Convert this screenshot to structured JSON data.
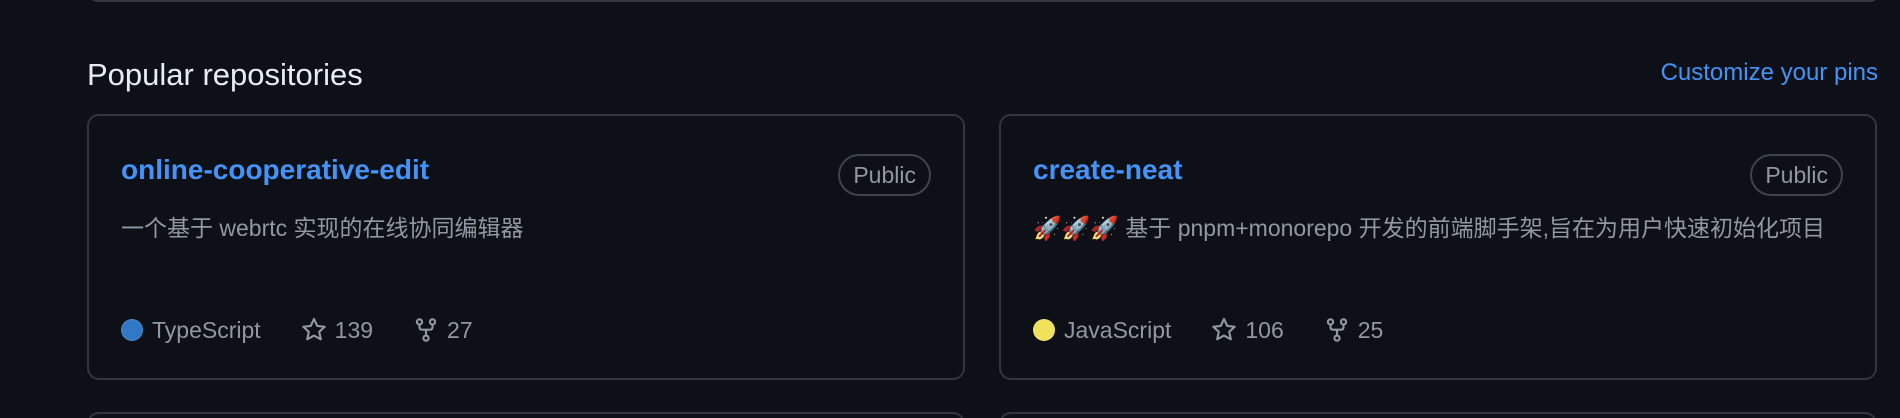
{
  "section": {
    "title": "Popular repositories",
    "customize_label": "Customize your pins"
  },
  "repos": [
    {
      "name": "online-cooperative-edit",
      "visibility": "Public",
      "description": "一个基于 webrtc 实现的在线协同编辑器",
      "language": "TypeScript",
      "language_color": "#3178c6",
      "stars": "139",
      "forks": "27"
    },
    {
      "name": "create-neat",
      "visibility": "Public",
      "description": "🚀🚀🚀 基于 pnpm+monorepo 开发的前端脚手架,旨在为用户快速初始化项目",
      "language": "JavaScript",
      "language_color": "#f1e05a",
      "stars": "106",
      "forks": "25"
    }
  ],
  "icons": {
    "star": "star-icon",
    "fork": "repo-forked-icon"
  },
  "colors": {
    "background": "#0d1117",
    "link": "#4493f8",
    "muted": "#9198a1",
    "border": "#30363d"
  }
}
